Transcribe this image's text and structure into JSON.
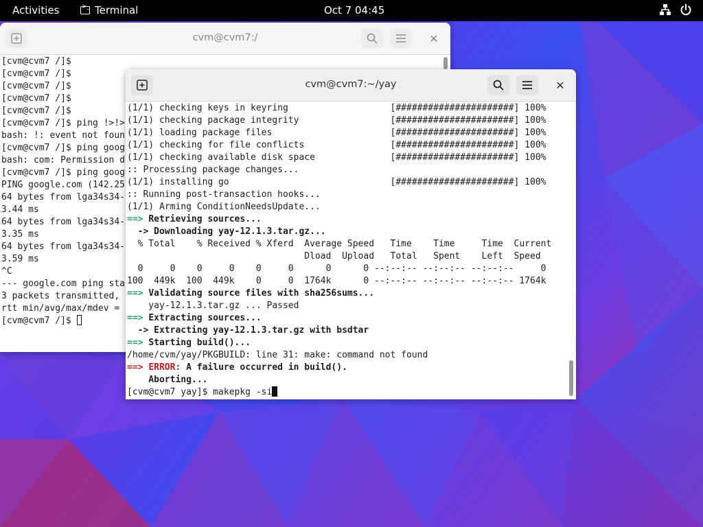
{
  "topbar": {
    "activities": "Activities",
    "app_name": "Terminal",
    "clock": "Oct 7  04:45",
    "tray_icons": [
      "network-icon",
      "power-icon"
    ]
  },
  "back_window": {
    "title": "cvm@cvm7:/",
    "lines": [
      "[cvm@cvm7 /]$",
      "[cvm@cvm7 /]$",
      "[cvm@cvm7 /]$",
      "[cvm@cvm7 /]$",
      "[cvm@cvm7 /]$",
      "[cvm@cvm7 /]$ ping !>!>",
      "bash: !: event not foun",
      "[cvm@cvm7 /]$ ping goog",
      "bash: com: Permission d",
      "[cvm@cvm7 /]$ ping goog",
      "PING google.com (142.25",
      "64 bytes from lga34s34-",
      "3.44 ms",
      "64 bytes from lga34s34-",
      "3.35 ms",
      "64 bytes from lga34s34-",
      "3.59 ms",
      "^C",
      "--- google.com ping sta",
      "3 packets transmitted,",
      "rtt min/avg/max/mdev =",
      "[cvm@cvm7 /]$ "
    ]
  },
  "front_window": {
    "title": "cvm@cvm7:~/yay",
    "lines": [
      {
        "t": "(1/1) checking keys in keyring                   [######################] 100%"
      },
      {
        "t": "(1/1) checking package integrity                 [######################] 100%"
      },
      {
        "t": "(1/1) loading package files                      [######################] 100%"
      },
      {
        "t": "(1/1) checking for file conflicts                [######################] 100%"
      },
      {
        "t": "(1/1) checking available disk space              [######################] 100%"
      },
      {
        "t": ":: Processing package changes..."
      },
      {
        "t": "(1/1) installing go                              [######################] 100%"
      },
      {
        "t": ":: Running post-transaction hooks..."
      },
      {
        "t": "(1/1) Arming ConditionNeedsUpdate..."
      },
      {
        "p": "==> ",
        "pc": "green",
        "t": "Retrieving sources...",
        "tc": "bold"
      },
      {
        "p": "  -> ",
        "pc": "bold",
        "t": "Downloading yay-12.1.3.tar.gz...",
        "tc": "bold"
      },
      {
        "t": "  % Total    % Received % Xferd  Average Speed   Time    Time     Time  Current"
      },
      {
        "t": "                                 Dload  Upload   Total   Spent    Left  Speed"
      },
      {
        "t": "  0     0    0     0    0     0      0      0 --:--:-- --:--:-- --:--:--     0"
      },
      {
        "t": "100  449k  100  449k    0     0  1764k      0 --:--:-- --:--:-- --:--:-- 1764k"
      },
      {
        "p": "==> ",
        "pc": "green",
        "t": "Validating source files with sha256sums...",
        "tc": "bold"
      },
      {
        "t": "    yay-12.1.3.tar.gz ... Passed"
      },
      {
        "p": "==> ",
        "pc": "green",
        "t": "Extracting sources...",
        "tc": "bold"
      },
      {
        "p": "  -> ",
        "pc": "bold",
        "t": "Extracting yay-12.1.3.tar.gz with bsdtar",
        "tc": "bold"
      },
      {
        "p": "==> ",
        "pc": "green",
        "t": "Starting build()...",
        "tc": "bold"
      },
      {
        "t": "/home/cvm/yay/PKGBUILD: line 31: make: command not found"
      },
      {
        "p": "==> ",
        "pc": "red",
        "e": "ERROR:",
        "t": " A failure occurred in build().",
        "tc": "bold"
      },
      {
        "t": "    Aborting...",
        "tc": "bold"
      },
      {
        "t": "[cvm@cvm7 yay]$ makepkg -si"
      }
    ]
  }
}
